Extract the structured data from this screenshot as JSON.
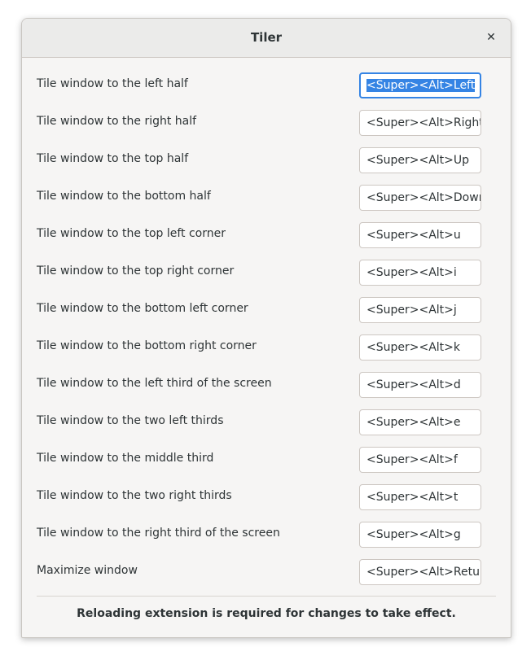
{
  "window": {
    "title": "Tiler",
    "close_glyph": "✕"
  },
  "shortcuts": [
    {
      "label": "Tile window to the left half",
      "value": "<Super><Alt>Left",
      "focused": true
    },
    {
      "label": "Tile window to the right half",
      "value": "<Super><Alt>Right"
    },
    {
      "label": "Tile window to the top half",
      "value": "<Super><Alt>Up"
    },
    {
      "label": "Tile window to the bottom half",
      "value": "<Super><Alt>Down"
    },
    {
      "label": "Tile window to the top left corner",
      "value": "<Super><Alt>u"
    },
    {
      "label": "Tile window to the top right corner",
      "value": "<Super><Alt>i"
    },
    {
      "label": "Tile window to the bottom left corner",
      "value": "<Super><Alt>j"
    },
    {
      "label": "Tile window to the bottom right corner",
      "value": "<Super><Alt>k"
    },
    {
      "label": "Tile window to the left third of the screen",
      "value": "<Super><Alt>d"
    },
    {
      "label": "Tile window to the two left thirds",
      "value": "<Super><Alt>e"
    },
    {
      "label": "Tile window to the middle third",
      "value": "<Super><Alt>f"
    },
    {
      "label": "Tile window to the two right thirds",
      "value": "<Super><Alt>t"
    },
    {
      "label": "Tile window to the right third of the screen",
      "value": "<Super><Alt>g"
    },
    {
      "label": "Maximize window",
      "value": "<Super><Alt>Return"
    }
  ],
  "footer": {
    "note": "Reloading extension is required for changes to take effect."
  },
  "colors": {
    "accent": "#3584e4",
    "text": "#2e3436",
    "background": "#f6f5f4"
  }
}
